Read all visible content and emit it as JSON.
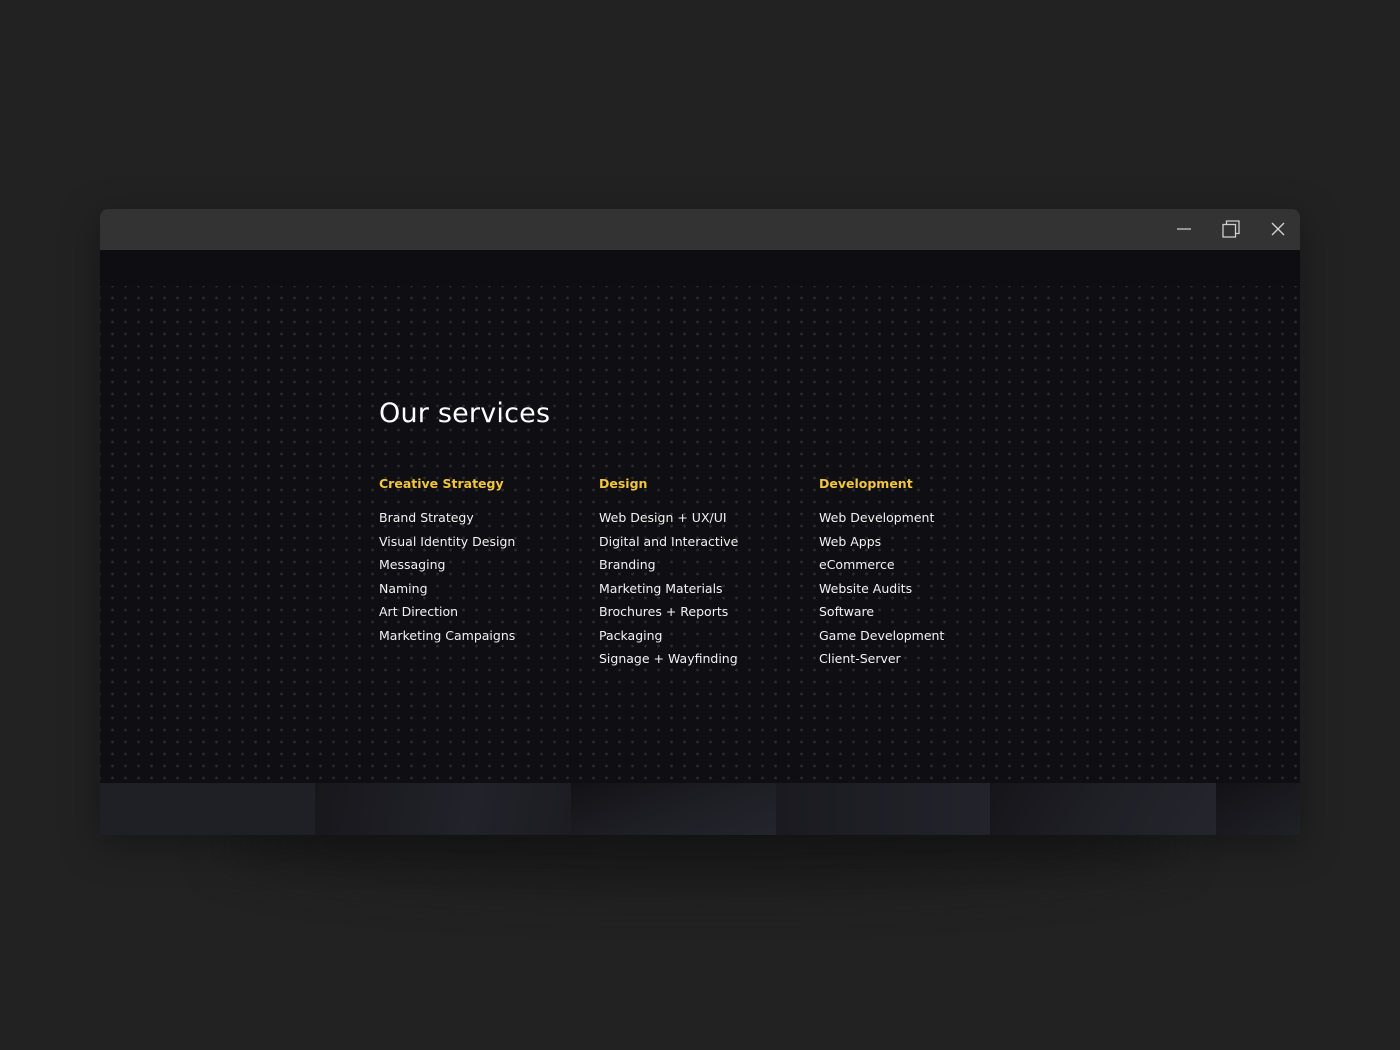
{
  "window": {
    "controls": {
      "minimize_icon": "minimize-icon",
      "maximize_icon": "restore-icon",
      "close_icon": "close-icon"
    }
  },
  "services": {
    "title": "Our services",
    "accent_color": "#f2c53d",
    "columns": [
      {
        "heading": "Creative Strategy",
        "items": [
          "Brand Strategy",
          "Visual Identity Design",
          "Messaging",
          "Naming",
          "Art Direction",
          "Marketing Campaigns"
        ]
      },
      {
        "heading": "Design",
        "items": [
          "Web Design + UX/UI",
          "Digital and Interactive",
          "Branding",
          "Marketing Materials",
          "Brochures + Reports",
          "Packaging",
          "Signage + Wayfinding"
        ]
      },
      {
        "heading": "Development",
        "items": [
          "Web Development",
          "Web Apps",
          "eCommerce",
          "Website Audits",
          "Software",
          "Game Development",
          "Client-Server"
        ]
      }
    ]
  }
}
